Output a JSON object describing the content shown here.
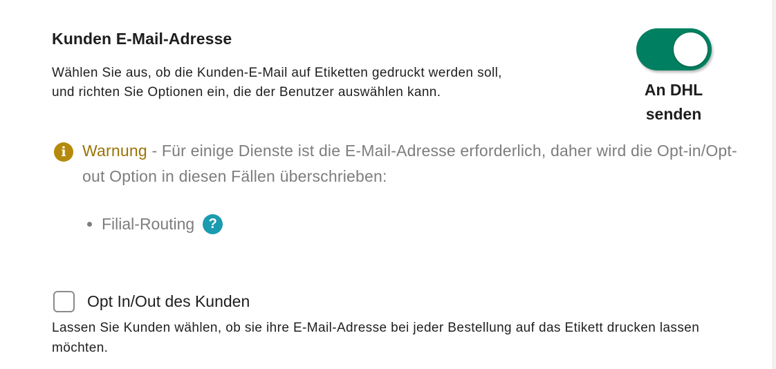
{
  "section": {
    "title": "Kunden E-Mail-Adresse",
    "description": "Wählen Sie aus, ob die Kunden-E-Mail auf Etiketten gedruckt werden soll, und richten Sie Optionen ein, die der Benutzer auswählen kann."
  },
  "toggle": {
    "on": true,
    "label": "An DHL senden",
    "color": "#008060"
  },
  "warning": {
    "icon": "info-icon",
    "label": "Warnung",
    "text": " - Für einige Dienste ist die E-Mail-Adresse erforderlich, daher wird die Opt-in/Opt-out Option in diesen Fällen überschrieben:",
    "color": "#9a7306",
    "items": [
      {
        "label": "Filial-Routing",
        "icon": "question-icon"
      }
    ]
  },
  "opt_in": {
    "checked": false,
    "label": "Opt In/Out des Kunden",
    "description": "Lassen Sie Kunden wählen, ob sie ihre E-Mail-Adresse bei jeder Bestellung auf das Etikett drucken lassen möchten."
  }
}
